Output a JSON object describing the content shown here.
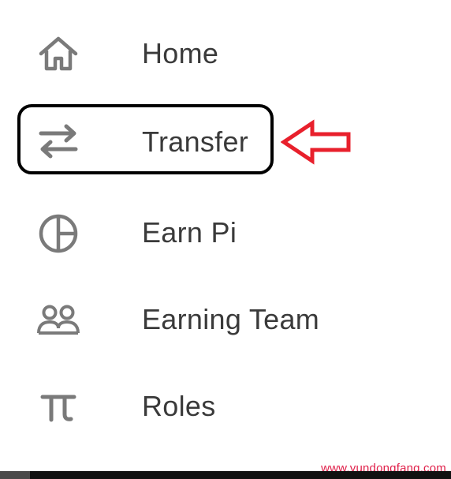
{
  "menu": {
    "items": [
      {
        "label": "Home",
        "icon": "home-icon"
      },
      {
        "label": "Transfer",
        "icon": "transfer-icon"
      },
      {
        "label": "Earn Pi",
        "icon": "pie-chart-icon"
      },
      {
        "label": "Earning Team",
        "icon": "team-icon"
      },
      {
        "label": "Roles",
        "icon": "pi-icon"
      }
    ]
  },
  "annotation": {
    "highlight_color": "#000000",
    "arrow_color": "#e8202c"
  },
  "watermark": {
    "text": "www.yundongfang.com",
    "color": "#e0204a"
  },
  "colors": {
    "icon": "#7a7a7a",
    "label": "#3a3a3a",
    "background": "#ffffff"
  }
}
